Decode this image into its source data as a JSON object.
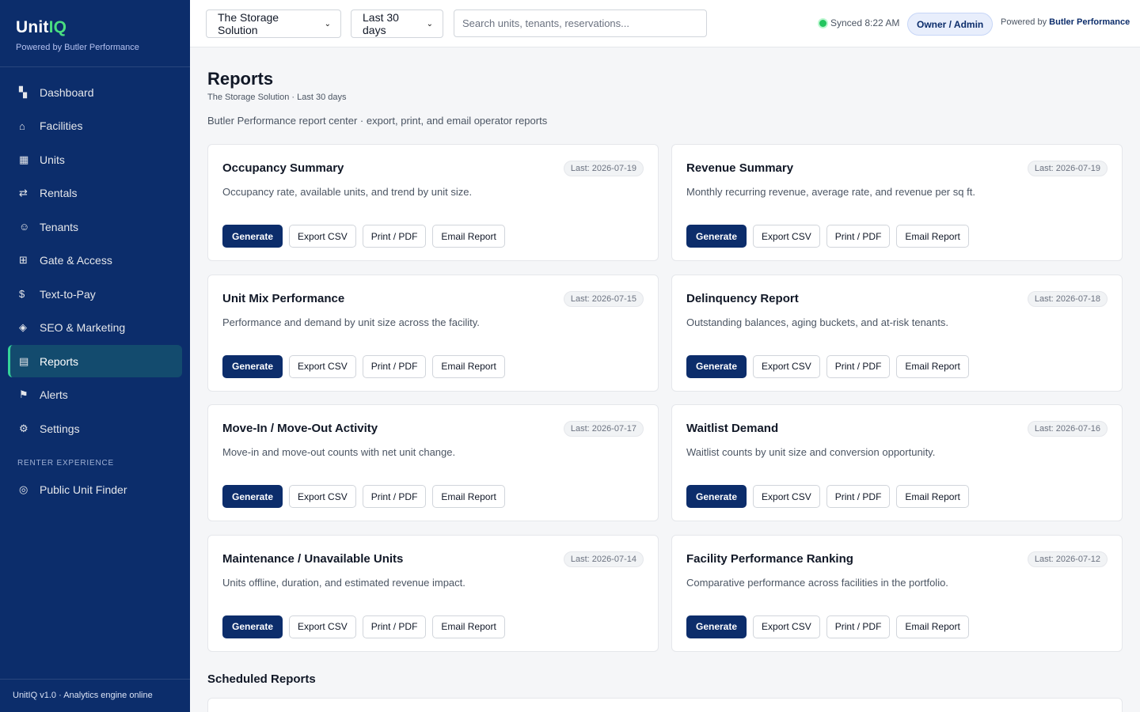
{
  "brand": {
    "logo_main": "Unit",
    "logo_accent": "IQ",
    "subtitle": "Powered by Butler Performance"
  },
  "sidebar": {
    "items": [
      {
        "label": "Dashboard",
        "icon": "dashboard-icon",
        "glyph": "▚"
      },
      {
        "label": "Facilities",
        "icon": "home-icon",
        "glyph": "⌂"
      },
      {
        "label": "Units",
        "icon": "grid-icon",
        "glyph": "▦"
      },
      {
        "label": "Rentals",
        "icon": "swap-icon",
        "glyph": "⇄"
      },
      {
        "label": "Tenants",
        "icon": "person-icon",
        "glyph": "☺"
      },
      {
        "label": "Gate & Access",
        "icon": "gate-icon",
        "glyph": "⊞"
      },
      {
        "label": "Text-to-Pay",
        "icon": "dollar-icon",
        "glyph": "$"
      },
      {
        "label": "SEO & Marketing",
        "icon": "diamond-icon",
        "glyph": "◈"
      },
      {
        "label": "Reports",
        "icon": "report-icon",
        "glyph": "▤",
        "active": true
      },
      {
        "label": "Alerts",
        "icon": "flag-icon",
        "glyph": "⚑"
      },
      {
        "label": "Settings",
        "icon": "gear-icon",
        "glyph": "⚙"
      }
    ],
    "section_label": "RENTER EXPERIENCE",
    "section_items": [
      {
        "label": "Public Unit Finder",
        "icon": "target-icon",
        "glyph": "◎"
      }
    ],
    "footer": "UnitIQ v1.0 · Analytics engine online"
  },
  "topbar": {
    "facility_select": "The Storage Solution",
    "range_select": "Last 30 days",
    "search_placeholder": "Search units, tenants, reservations...",
    "sync_status": "Synced 8:22 AM",
    "role": "Owner / Admin",
    "powered_prefix": "Powered by",
    "powered_brand": "Butler Performance"
  },
  "page": {
    "title": "Reports",
    "subtitle": "The Storage Solution · Last 30 days",
    "description": "Butler Performance report center · export, print, and email operator reports"
  },
  "actions": {
    "generate": "Generate",
    "export_csv": "Export CSV",
    "print_pdf": "Print / PDF",
    "email": "Email Report"
  },
  "reports": [
    {
      "title": "Occupancy Summary",
      "last": "Last: 2026-07-19",
      "desc": "Occupancy rate, available units, and trend by unit size."
    },
    {
      "title": "Revenue Summary",
      "last": "Last: 2026-07-19",
      "desc": "Monthly recurring revenue, average rate, and revenue per sq ft."
    },
    {
      "title": "Unit Mix Performance",
      "last": "Last: 2026-07-15",
      "desc": "Performance and demand by unit size across the facility."
    },
    {
      "title": "Delinquency Report",
      "last": "Last: 2026-07-18",
      "desc": "Outstanding balances, aging buckets, and at-risk tenants."
    },
    {
      "title": "Move-In / Move-Out Activity",
      "last": "Last: 2026-07-17",
      "desc": "Move-in and move-out counts with net unit change."
    },
    {
      "title": "Waitlist Demand",
      "last": "Last: 2026-07-16",
      "desc": "Waitlist counts by unit size and conversion opportunity."
    },
    {
      "title": "Maintenance / Unavailable Units",
      "last": "Last: 2026-07-14",
      "desc": "Units offline, duration, and estimated revenue impact."
    },
    {
      "title": "Facility Performance Ranking",
      "last": "Last: 2026-07-12",
      "desc": "Comparative performance across facilities in the portfolio."
    }
  ],
  "scheduled": {
    "title": "Scheduled Reports"
  }
}
